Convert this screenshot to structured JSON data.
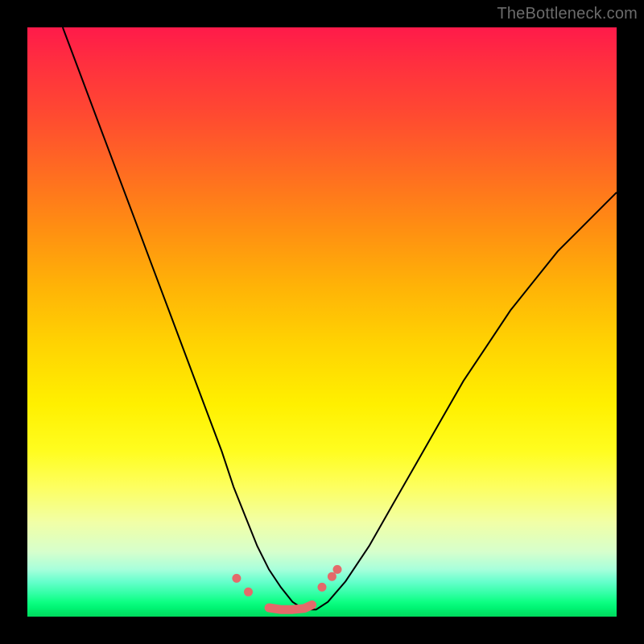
{
  "watermark_text": "TheBottleneck.com",
  "chart_data": {
    "type": "line",
    "title": "",
    "xlabel": "",
    "ylabel": "",
    "xlim": [
      0,
      100
    ],
    "ylim": [
      0,
      100
    ],
    "series": [
      {
        "name": "bottleneck-curve",
        "x": [
          6,
          9,
          12,
          15,
          18,
          21,
          24,
          27,
          30,
          33,
          35,
          37,
          39,
          41,
          43,
          45,
          47,
          49,
          51,
          54,
          58,
          62,
          66,
          70,
          74,
          78,
          82,
          86,
          90,
          94,
          98,
          100
        ],
        "y": [
          100,
          92,
          84,
          76,
          68,
          60,
          52,
          44,
          36,
          28,
          22,
          17,
          12,
          8,
          5,
          2.5,
          1.2,
          1.2,
          2.5,
          6,
          12,
          19,
          26,
          33,
          40,
          46,
          52,
          57,
          62,
          66,
          70,
          72
        ]
      }
    ],
    "markers": {
      "name": "bottom-dots",
      "points": [
        {
          "x": 35.5,
          "y": 6.5
        },
        {
          "x": 37.5,
          "y": 4.2
        },
        {
          "x": 50.0,
          "y": 5.0
        },
        {
          "x": 51.7,
          "y": 6.8
        },
        {
          "x": 52.6,
          "y": 8.0
        },
        {
          "x": 41.0,
          "y": 1.5
        },
        {
          "x": 43.0,
          "y": 1.2
        },
        {
          "x": 45.0,
          "y": 1.2
        },
        {
          "x": 47.0,
          "y": 1.4
        },
        {
          "x": 48.3,
          "y": 2.0
        }
      ]
    },
    "background_gradient": {
      "top": "#ff1a4a",
      "mid": "#fff000",
      "bottom": "#00d95d"
    }
  }
}
